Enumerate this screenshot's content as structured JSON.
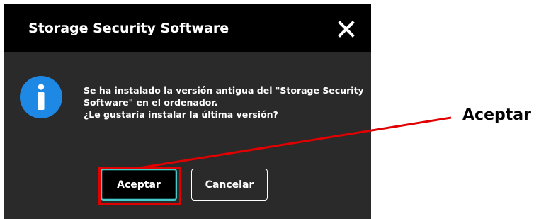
{
  "dialog": {
    "title": "Storage Security Software",
    "close_icon": "close-icon",
    "info_icon": "info-icon",
    "message_lines": [
      "Se ha instalado la versión antigua del \"Storage Security",
      "Software\" en el ordenador.",
      "¿Le gustaría instalar la última versión?"
    ],
    "buttons": {
      "accept_label": "Aceptar",
      "cancel_label": "Cancelar"
    },
    "colors": {
      "titlebar": "#000000",
      "body": "#2a2a2a",
      "info_icon": "#1e88e5",
      "accept_border": "#46c9c9"
    }
  },
  "annotation": {
    "label": "Aceptar",
    "color": "#e00000"
  }
}
